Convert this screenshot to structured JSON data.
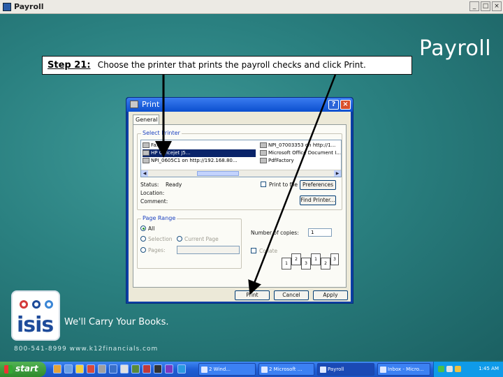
{
  "window": {
    "title": "Payroll",
    "btn_min": "_",
    "btn_max": "□",
    "btn_close": "×"
  },
  "slide": {
    "title": "Payroll",
    "step_label": "Step 21:",
    "step_text": "Choose the printer that prints the payroll checks and click Print."
  },
  "dialog": {
    "title": "Print",
    "help": "?",
    "close": "×",
    "tab": "General",
    "select_printer_label": "Select Printer",
    "printers_left": [
      "Fax",
      "HP Officejet J5...",
      "NPI_0605C1 on http://192.168.80..."
    ],
    "printers_right": [
      "NPI_07003353 on http://1...",
      "Microsoft Office Document I...",
      "PdfFactory"
    ],
    "status_label": "Status:",
    "status_value": "Ready",
    "location_label": "Location:",
    "comment_label": "Comment:",
    "print_to_file": "Print to file",
    "preferences": "Preferences",
    "find_printer": "Find Printer...",
    "page_range_label": "Page Range",
    "all": "All",
    "selection": "Selection",
    "current_page": "Current Page",
    "pages": "Pages:",
    "copies_label": "Number of copies:",
    "copies_value": "1",
    "collate": "Collate",
    "collate_pages": [
      "1",
      "2",
      "3",
      "1",
      "2",
      "3"
    ],
    "print_btn": "Print",
    "cancel_btn": "Cancel",
    "apply_btn": "Apply"
  },
  "branding": {
    "logo_text": "isis",
    "tagline": "We'll Carry Your Books.",
    "contact": "800-541-8999   www.k12financials.com"
  },
  "taskbar": {
    "start": "start",
    "tasks": [
      "2 Wind... ",
      "2 Microsoft ...",
      "Payroll",
      "Inbox - Micro..."
    ],
    "clock": "1:45 AM"
  }
}
